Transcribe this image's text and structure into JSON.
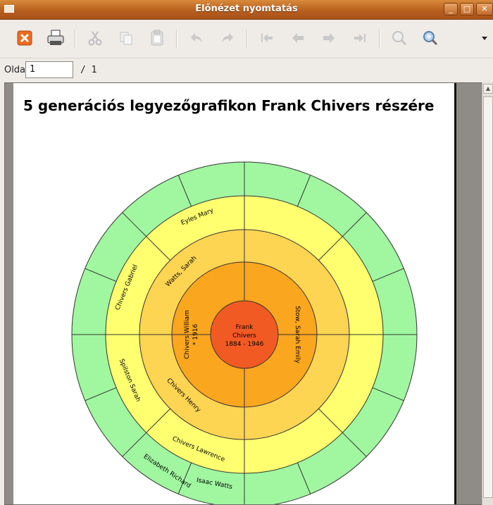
{
  "window": {
    "title": "Előnézet nyomtatás"
  },
  "pagebar": {
    "label": "Oldal:",
    "page_value": "1",
    "total": "/ 1"
  },
  "page": {
    "title": "5 generációs legyezőgrafikon Frank Chivers részére",
    "center": {
      "line1": "Frank",
      "line2": "Chivers",
      "line3": "1884 - 1946"
    },
    "gen2": [
      {
        "name": "Chivers William",
        "detail": "* 1916"
      },
      {
        "name": "Stow, Sarah Emily"
      }
    ],
    "gen3": [
      "Watts, Sarah",
      "Chivers Henry"
    ],
    "gen4": [
      "Eyles Mary",
      "Chivers Gabriel",
      "Spilston Sarah",
      "Chivers Lawrence"
    ],
    "gen5": [
      "Elizabeth Richard",
      "Isaac Watts"
    ]
  },
  "colors": {
    "titlebar": "#b8601f",
    "ring_center": "#f25a24",
    "ring_gen2": "#fba61f",
    "ring_gen3": "#fed453",
    "ring_gen4": "#ffff70",
    "ring_gen5": "#a0f7a0"
  }
}
